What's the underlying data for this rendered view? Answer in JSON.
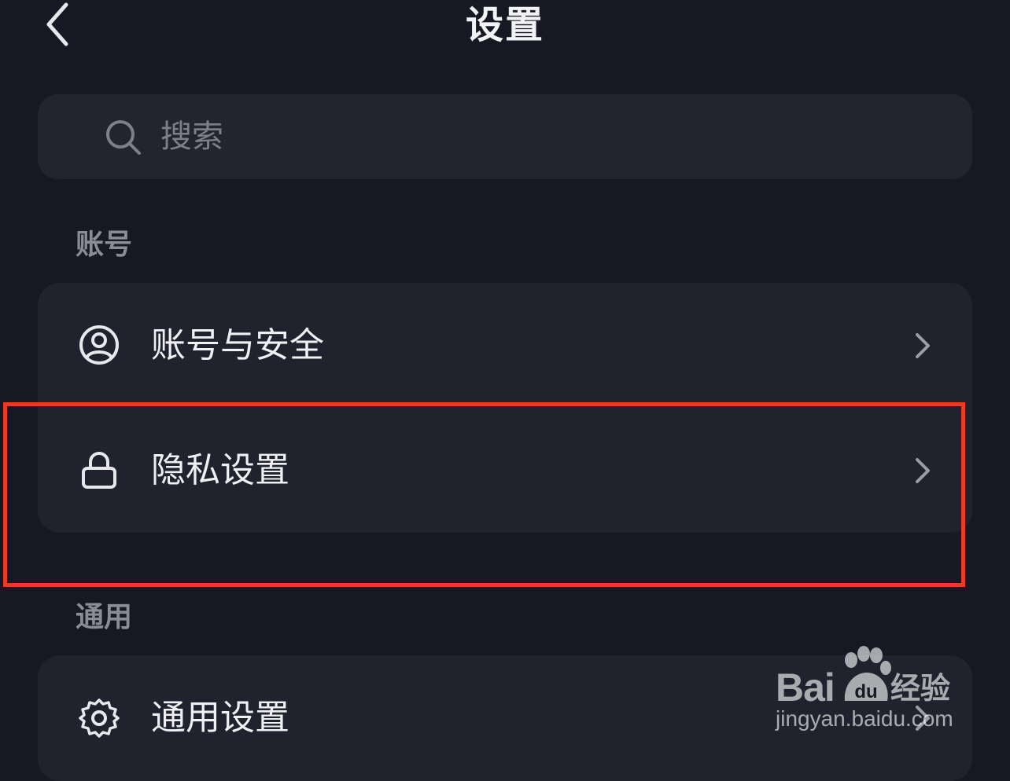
{
  "header": {
    "title": "设置",
    "back_icon": "chevron-left-icon"
  },
  "search": {
    "placeholder": "搜索",
    "icon": "search-icon"
  },
  "sections": {
    "account": {
      "title": "账号",
      "items": [
        {
          "label": "账号与安全",
          "icon": "user-circle-icon"
        },
        {
          "label": "隐私设置",
          "icon": "lock-icon"
        }
      ]
    },
    "general": {
      "title": "通用",
      "items": [
        {
          "label": "通用设置",
          "icon": "gear-icon"
        }
      ]
    }
  },
  "watermark": {
    "brand": "Bai",
    "brand_du": "du",
    "product": "经验",
    "url": "jingyan.baidu.com"
  },
  "colors": {
    "background": "#161823",
    "card": "#20222d",
    "highlight": "#ee3a22"
  }
}
